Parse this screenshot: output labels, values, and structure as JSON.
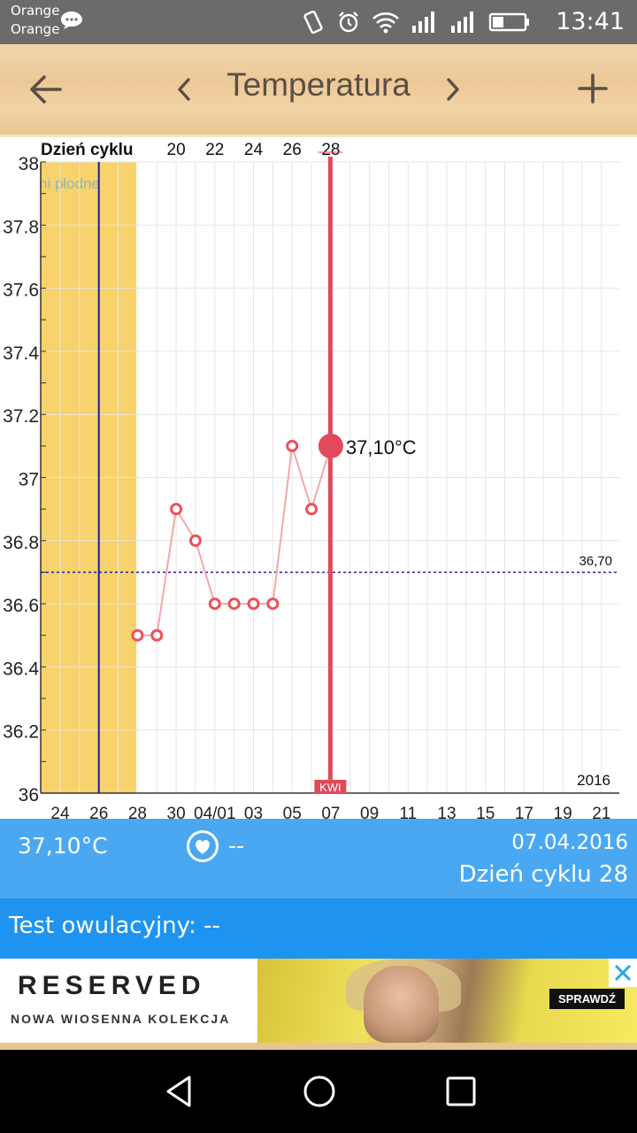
{
  "status_bar": {
    "carrier_1": "Orange",
    "carrier_2": "Orange",
    "time": "13:41"
  },
  "app_bar": {
    "title": "Temperatura"
  },
  "chart_data": {
    "type": "line",
    "title": "",
    "top_label": "Dzień cyklu",
    "y_ticks": [
      "38",
      "37.8",
      "37.6",
      "37.4",
      "37.2",
      "37",
      "36.8",
      "36.6",
      "36.4",
      "36.2",
      "36"
    ],
    "ylim": [
      36,
      38
    ],
    "x_tick_labels": [
      "24",
      "26",
      "28",
      "30",
      "04/01",
      "03",
      "05",
      "07",
      "09",
      "11",
      "13",
      "15",
      "17",
      "19",
      "21"
    ],
    "cycle_day_ticks": [
      "20",
      "22",
      "24",
      "26",
      "28"
    ],
    "fertile_label": "ni płodne",
    "series": [
      {
        "values": [
          36.5,
          36.5,
          36.9,
          36.8,
          36.6,
          36.6,
          36.6,
          36.6,
          37.1,
          36.9,
          37.1
        ]
      }
    ],
    "coverline": {
      "value": 36.7,
      "label": "36,70"
    },
    "selected": {
      "value": 37.1,
      "label": "37,10°C"
    },
    "month_marker": "KWI",
    "year": "2016",
    "colors": {
      "line": "#f4a7aa",
      "point": "#ef4f5a",
      "selected": "#e04a5a",
      "fertile": "#f8d26a",
      "coverline": "#1a1ab0",
      "ovulation": "#1a1ab0"
    }
  },
  "info": {
    "temperature": "37,10°C",
    "sign_value": "--",
    "date": "07.04.2016",
    "cycle_day": "Dzień cyklu 28"
  },
  "test": {
    "label": "Test owulacyjny: --"
  },
  "ad": {
    "brand": "RESERVED",
    "tagline": "NOWA WIOSENNA KOLEKCJA",
    "cta": "SPRAWDŹ"
  }
}
